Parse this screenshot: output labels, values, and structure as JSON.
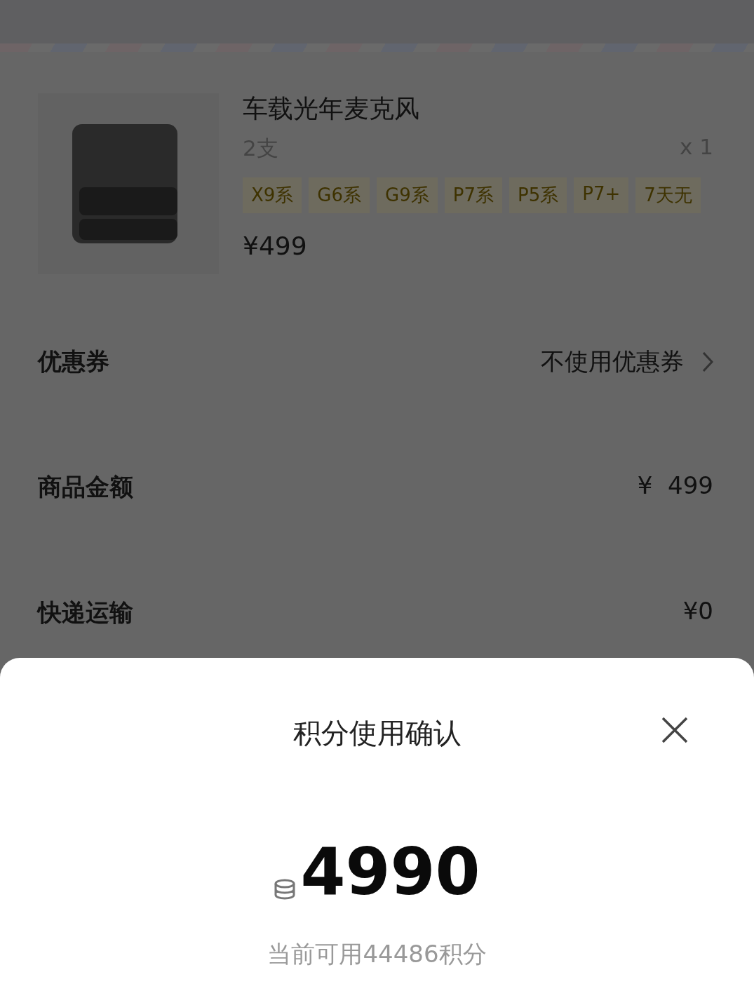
{
  "order": {
    "product": {
      "title": "车载光年麦克风",
      "spec": "2支",
      "quantity": "x 1",
      "tags": [
        "X9系",
        "G6系",
        "G9系",
        "P7系",
        "P5系",
        "P7+",
        "7天无"
      ],
      "price": "¥499"
    },
    "rows": [
      {
        "label": "优惠券",
        "value": "不使用优惠券",
        "kind": "link"
      },
      {
        "label": "商品金额",
        "value": "¥  499",
        "kind": "plain"
      },
      {
        "label": "快递运输",
        "value": "¥0",
        "kind": "plain"
      }
    ]
  },
  "dialog": {
    "title": "积分使用确认",
    "points": "4990",
    "available": "当前可用44486积分"
  }
}
